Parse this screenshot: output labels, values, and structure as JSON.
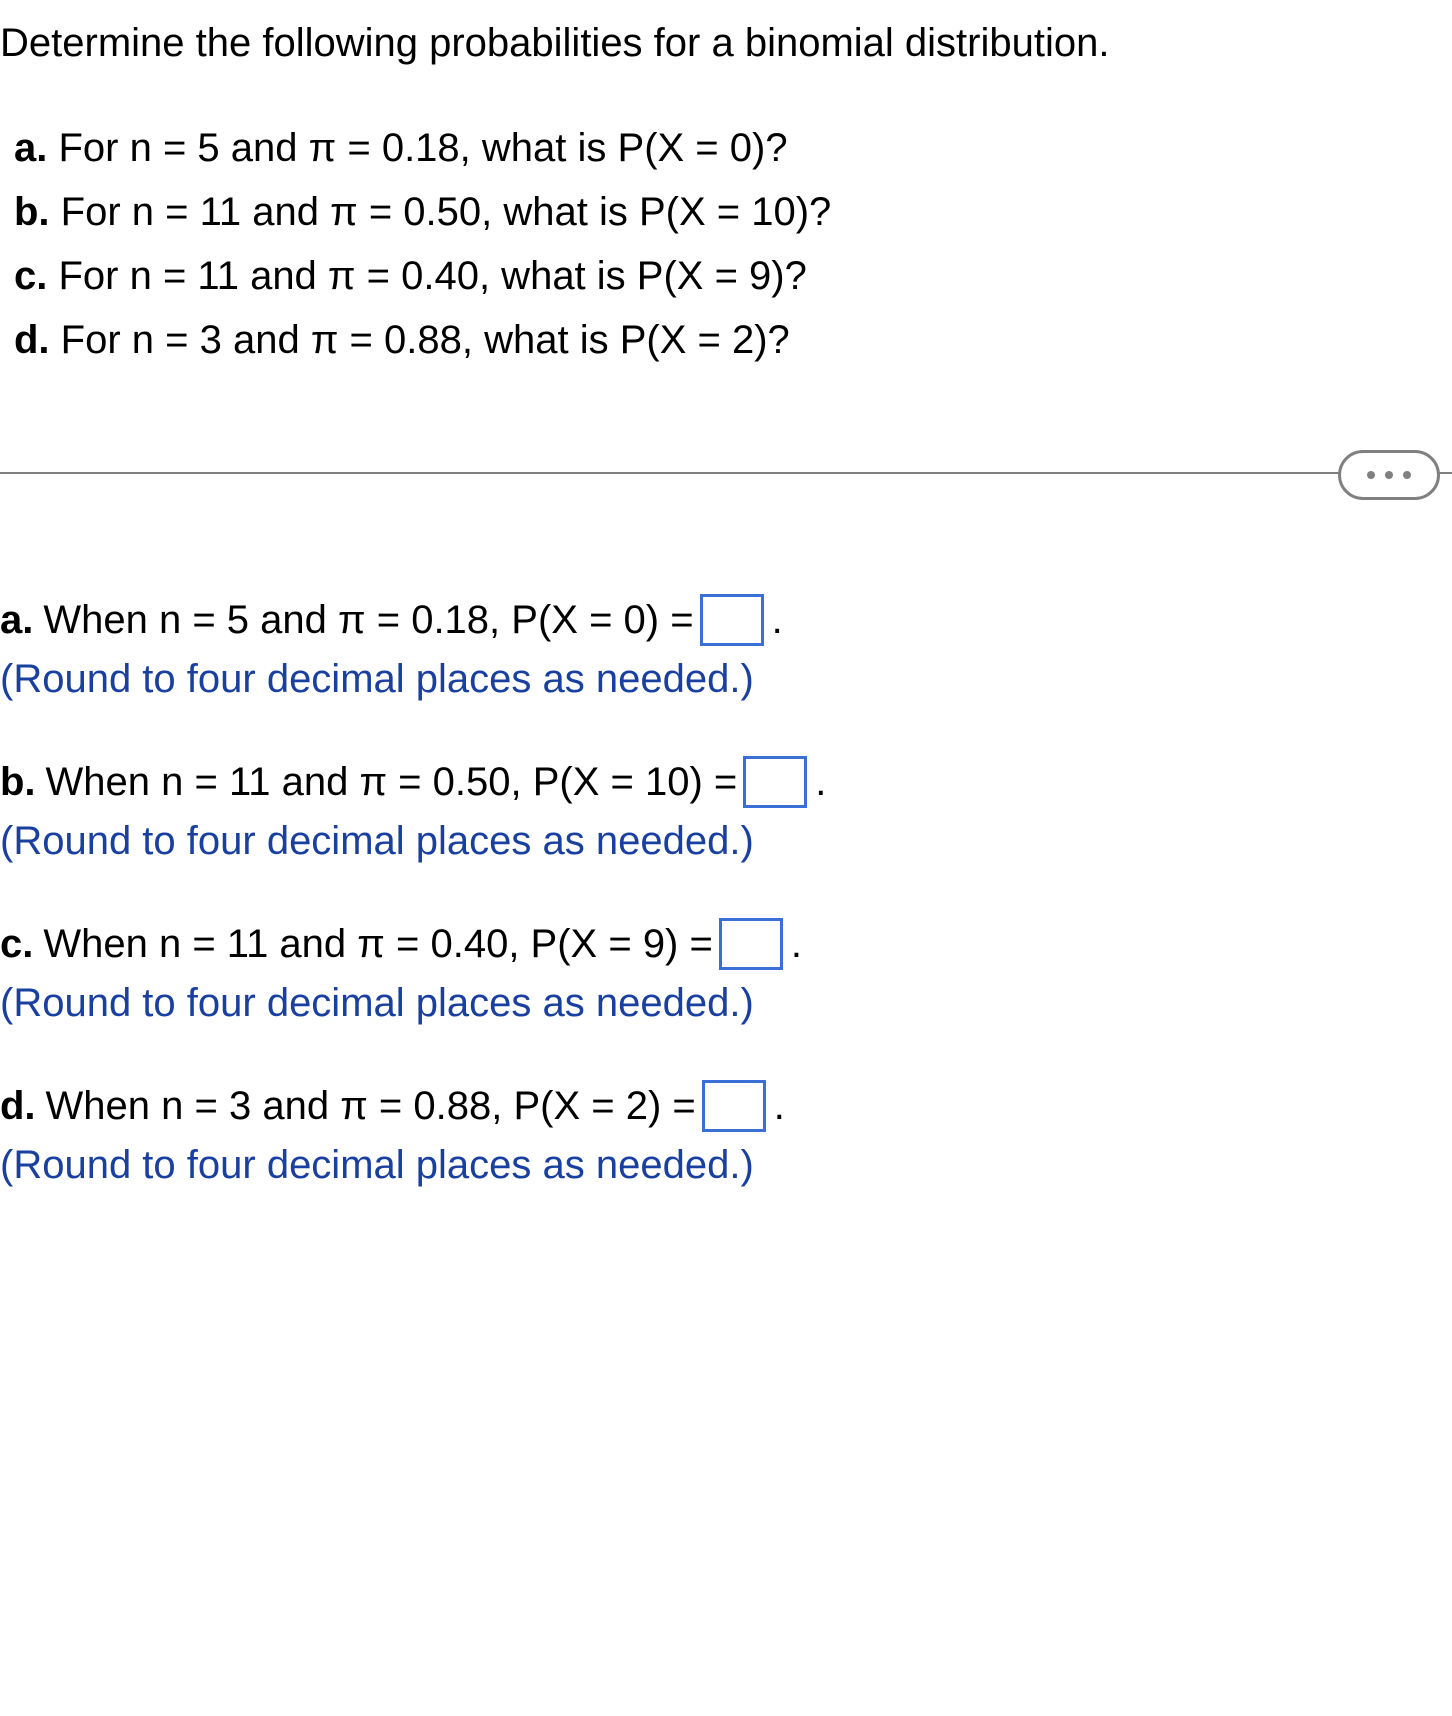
{
  "intro": "Determine the following probabilities for a binomial distribution.",
  "prompts": [
    {
      "label": "a.",
      "text": "For n = 5 and π = 0.18, what is P(X = 0)?"
    },
    {
      "label": "b.",
      "text": "For n = 11 and π = 0.50, what is P(X = 10)?"
    },
    {
      "label": "c.",
      "text": "For n = 11 and π = 0.40, what is P(X = 9)?"
    },
    {
      "label": "d.",
      "text": "For n = 3 and π = 0.88, what is P(X = 2)?"
    }
  ],
  "answers": [
    {
      "label": "a.",
      "lead": "When n = 5 and π = 0.18, P(X = 0) =",
      "hint": "(Round to four decimal places as needed.)"
    },
    {
      "label": "b.",
      "lead": "When n = 11 and π = 0.50, P(X = 10) =",
      "hint": "(Round to four decimal places as needed.)"
    },
    {
      "label": "c.",
      "lead": "When n = 11 and π = 0.40, P(X = 9) =",
      "hint": "(Round to four decimal places as needed.)"
    },
    {
      "label": "d.",
      "lead": "When n = 3 and π = 0.88, P(X = 2) =",
      "hint": "(Round to four decimal places as needed.)"
    }
  ],
  "period": "."
}
